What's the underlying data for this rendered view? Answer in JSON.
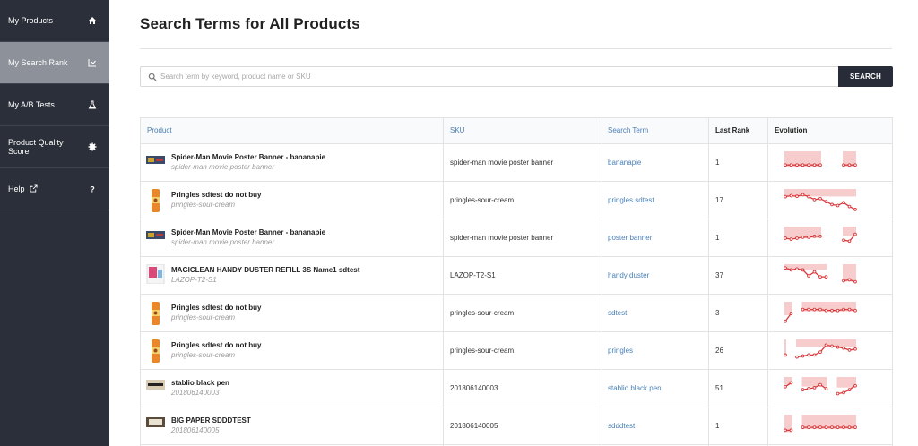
{
  "sidebar": {
    "items": [
      {
        "label": "My Products",
        "icon": "home-icon",
        "active": false
      },
      {
        "label": "My Search Rank",
        "icon": "chart-line-icon",
        "active": true
      },
      {
        "label": "My A/B Tests",
        "icon": "flask-icon",
        "active": false
      },
      {
        "label": "Product Quality Score",
        "icon": "gear-badge-icon",
        "active": false
      },
      {
        "label": "Help",
        "icon": "question-icon",
        "active": false
      }
    ]
  },
  "main": {
    "title": "Search Terms for All Products",
    "search": {
      "placeholder": "Search term by keyword, product name or SKU",
      "value": "",
      "button": "SEARCH"
    }
  },
  "table": {
    "headers": {
      "product": "Product",
      "sku": "SKU",
      "term": "Search Term",
      "rank": "Last Rank",
      "evolution": "Evolution"
    },
    "rows": [
      {
        "name": "Spider-Man Movie Poster Banner - bananapie",
        "sub": "spider-man movie poster banner",
        "sku": "spider-man movie poster banner",
        "term": "bananapie",
        "rank": "1",
        "thumb": "poster"
      },
      {
        "name": "Pringles sdtest do not buy",
        "sub": "pringles-sour-cream",
        "sku": "pringles-sour-cream",
        "term": "pringles sdtest",
        "rank": "17",
        "thumb": "can"
      },
      {
        "name": "Spider-Man Movie Poster Banner - bananapie",
        "sub": "spider-man movie poster banner",
        "sku": "spider-man movie poster banner",
        "term": "poster banner",
        "rank": "1",
        "thumb": "poster"
      },
      {
        "name": "MAGICLEAN HANDY DUSTER REFILL 3S Name1 sdtest",
        "sub": "LAZOP-T2-S1",
        "sku": "LAZOP-T2-S1",
        "term": "handy duster",
        "rank": "37",
        "thumb": "box"
      },
      {
        "name": "Pringles sdtest do not buy",
        "sub": "pringles-sour-cream",
        "sku": "pringles-sour-cream",
        "term": "sdtest",
        "rank": "3",
        "thumb": "can"
      },
      {
        "name": "Pringles sdtest do not buy",
        "sub": "pringles-sour-cream",
        "sku": "pringles-sour-cream",
        "term": "pringles",
        "rank": "26",
        "thumb": "can"
      },
      {
        "name": "stablio black pen",
        "sub": "201806140003",
        "sku": "201806140003",
        "term": "stablio black pen",
        "rank": "51",
        "thumb": "pen"
      },
      {
        "name": "BIG PAPER SDDDTEST",
        "sub": "201806140005",
        "sku": "201806140005",
        "term": "sdddtest",
        "rank": "1",
        "thumb": "paper"
      }
    ]
  },
  "evolution": {
    "color": "#d9383a",
    "band_color": "#f6cccd",
    "series": [
      [
        [
          0.6,
          1
        ],
        [
          0.6,
          1
        ],
        [
          0.6,
          1
        ],
        [
          0.6,
          1
        ],
        [
          0.6,
          1
        ],
        [
          0.6,
          1
        ],
        [
          0.6,
          1
        ],
        null,
        null,
        null,
        [
          0.6,
          1
        ],
        [
          0.6,
          1
        ],
        [
          0.6,
          1
        ]
      ],
      [
        [
          0.3,
          1
        ],
        [
          0.25,
          1
        ],
        [
          0.28,
          1
        ],
        [
          0.2,
          1
        ],
        [
          0.3,
          1
        ],
        [
          0.45,
          1
        ],
        [
          0.4,
          1
        ],
        [
          0.55,
          1
        ],
        [
          0.7,
          1
        ],
        [
          0.75,
          1
        ],
        [
          0.6,
          1
        ],
        [
          0.8,
          1
        ],
        [
          0.95,
          1
        ]
      ],
      [
        [
          0.5,
          1
        ],
        [
          0.55,
          1
        ],
        [
          0.5,
          1
        ],
        [
          0.45,
          1
        ],
        [
          0.45,
          1
        ],
        [
          0.4,
          1
        ],
        [
          0.4,
          1
        ],
        null,
        null,
        null,
        [
          0.6,
          1
        ],
        [
          0.65,
          1
        ],
        [
          0.3,
          1
        ]
      ],
      [
        [
          0.1,
          1
        ],
        [
          0.2,
          1
        ],
        [
          0.15,
          1
        ],
        [
          0.2,
          1
        ],
        [
          0.5,
          1
        ],
        [
          0.3,
          1
        ],
        [
          0.55,
          1
        ],
        [
          0.55,
          1
        ],
        null,
        null,
        [
          0.75,
          1
        ],
        [
          0.7,
          1
        ],
        [
          0.8,
          1
        ]
      ],
      [
        [
          0.9,
          1
        ],
        [
          0.5,
          1
        ],
        null,
        [
          0.3,
          1
        ],
        [
          0.3,
          1
        ],
        [
          0.3,
          1
        ],
        [
          0.3,
          1
        ],
        [
          0.35,
          1
        ],
        [
          0.35,
          1
        ],
        [
          0.35,
          1
        ],
        [
          0.3,
          1
        ],
        [
          0.3,
          1
        ],
        [
          0.35,
          1
        ]
      ],
      [
        [
          0.7,
          1
        ],
        null,
        [
          0.8,
          1
        ],
        [
          0.75,
          1
        ],
        [
          0.7,
          1
        ],
        [
          0.7,
          1
        ],
        [
          0.55,
          1
        ],
        [
          0.2,
          1
        ],
        [
          0.25,
          1
        ],
        [
          0.3,
          1
        ],
        [
          0.35,
          1
        ],
        [
          0.45,
          1
        ],
        [
          0.4,
          1
        ]
      ],
      [
        [
          0.4,
          1
        ],
        [
          0.2,
          1
        ],
        null,
        [
          0.55,
          1
        ],
        [
          0.5,
          1
        ],
        [
          0.45,
          1
        ],
        [
          0.3,
          1
        ],
        [
          0.5,
          1
        ],
        null,
        [
          0.75,
          1
        ],
        [
          0.7,
          1
        ],
        [
          0.55,
          1
        ],
        [
          0.35,
          1
        ]
      ],
      [
        [
          0.7,
          1
        ],
        [
          0.7,
          1
        ],
        null,
        [
          0.55,
          1
        ],
        [
          0.55,
          1
        ],
        [
          0.55,
          1
        ],
        [
          0.55,
          1
        ],
        [
          0.55,
          1
        ],
        [
          0.55,
          1
        ],
        [
          0.55,
          1
        ],
        [
          0.55,
          1
        ],
        [
          0.55,
          1
        ],
        [
          0.55,
          1
        ]
      ]
    ]
  }
}
